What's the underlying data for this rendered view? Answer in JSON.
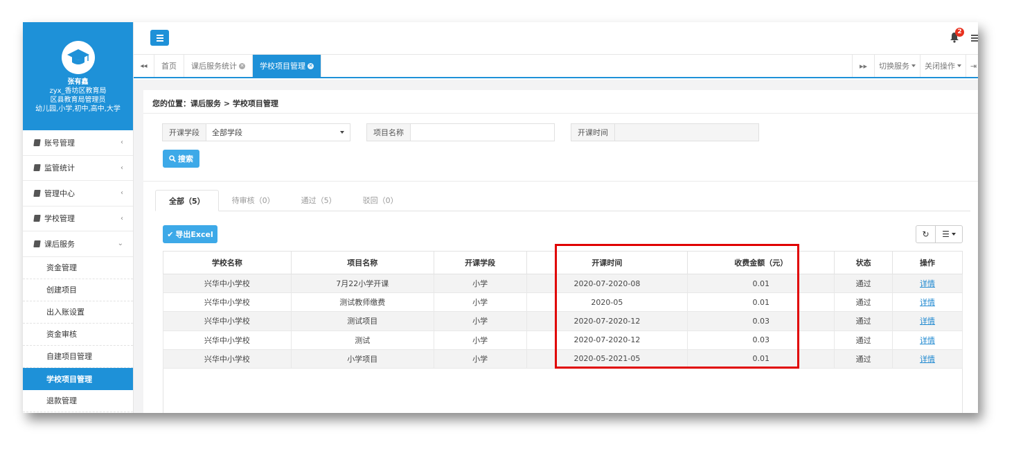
{
  "profile": {
    "name": "张有鑫",
    "lines": [
      "zyx_香坊区教育局",
      "区县教育局管理员",
      "幼儿园,小学,初中,高中,大学"
    ]
  },
  "sidebar": {
    "items": [
      {
        "label": "账号管理",
        "chevron": "‹"
      },
      {
        "label": "监管统计",
        "chevron": "‹"
      },
      {
        "label": "管理中心",
        "chevron": "‹"
      },
      {
        "label": "学校管理",
        "chevron": "‹"
      },
      {
        "label": "课后服务",
        "chevron": "⌄"
      }
    ],
    "subitems": [
      "资金管理",
      "创建项目",
      "出入账设置",
      "资金审核",
      "自建项目管理",
      "学校项目管理",
      "退款管理"
    ]
  },
  "topbar": {
    "badge_count": "2"
  },
  "tabs": {
    "nav_left": "◂◂",
    "nav_right": "▸▸",
    "items": [
      {
        "label": "首页"
      },
      {
        "label": "课后服务统计"
      },
      {
        "label": "学校项目管理"
      }
    ],
    "tools": {
      "switch_service": "切换服务",
      "close_ops": "关闭操作"
    }
  },
  "breadcrumb": "您的位置：课后服务 > 学校项目管理",
  "filters": {
    "stage_label": "开课学段",
    "stage_value": "全部学段",
    "project_label": "项目名称",
    "project_value": "",
    "time_label": "开课时间",
    "time_value": ""
  },
  "buttons": {
    "search": "搜索",
    "export": "导出Excel"
  },
  "status_tabs": [
    {
      "label": "全部（5）"
    },
    {
      "label": "待审核（0）"
    },
    {
      "label": "通过（5）"
    },
    {
      "label": "驳回（0）"
    }
  ],
  "table": {
    "headers": [
      "学校名称",
      "项目名称",
      "开课学段",
      "开课时间",
      "收费金额（元）",
      "状态",
      "操作"
    ],
    "rows": [
      [
        "兴华中小学校",
        "7月22小学开课",
        "小学",
        "2020-07-2020-08",
        "0.01",
        "通过",
        "详情"
      ],
      [
        "兴华中小学校",
        "测试教师缴费",
        "小学",
        "2020-05",
        "0.01",
        "通过",
        "详情"
      ],
      [
        "兴华中小学校",
        "测试项目",
        "小学",
        "2020-07-2020-12",
        "0.03",
        "通过",
        "详情"
      ],
      [
        "兴华中小学校",
        "测试",
        "小学",
        "2020-07-2020-12",
        "0.03",
        "通过",
        "详情"
      ],
      [
        "兴华中小学校",
        "小学项目",
        "小学",
        "2020-05-2021-05",
        "0.01",
        "通过",
        "详情"
      ]
    ]
  },
  "colors": {
    "accent": "#1e91d8",
    "highlight": "#e00000",
    "badge": "#e8311f"
  }
}
